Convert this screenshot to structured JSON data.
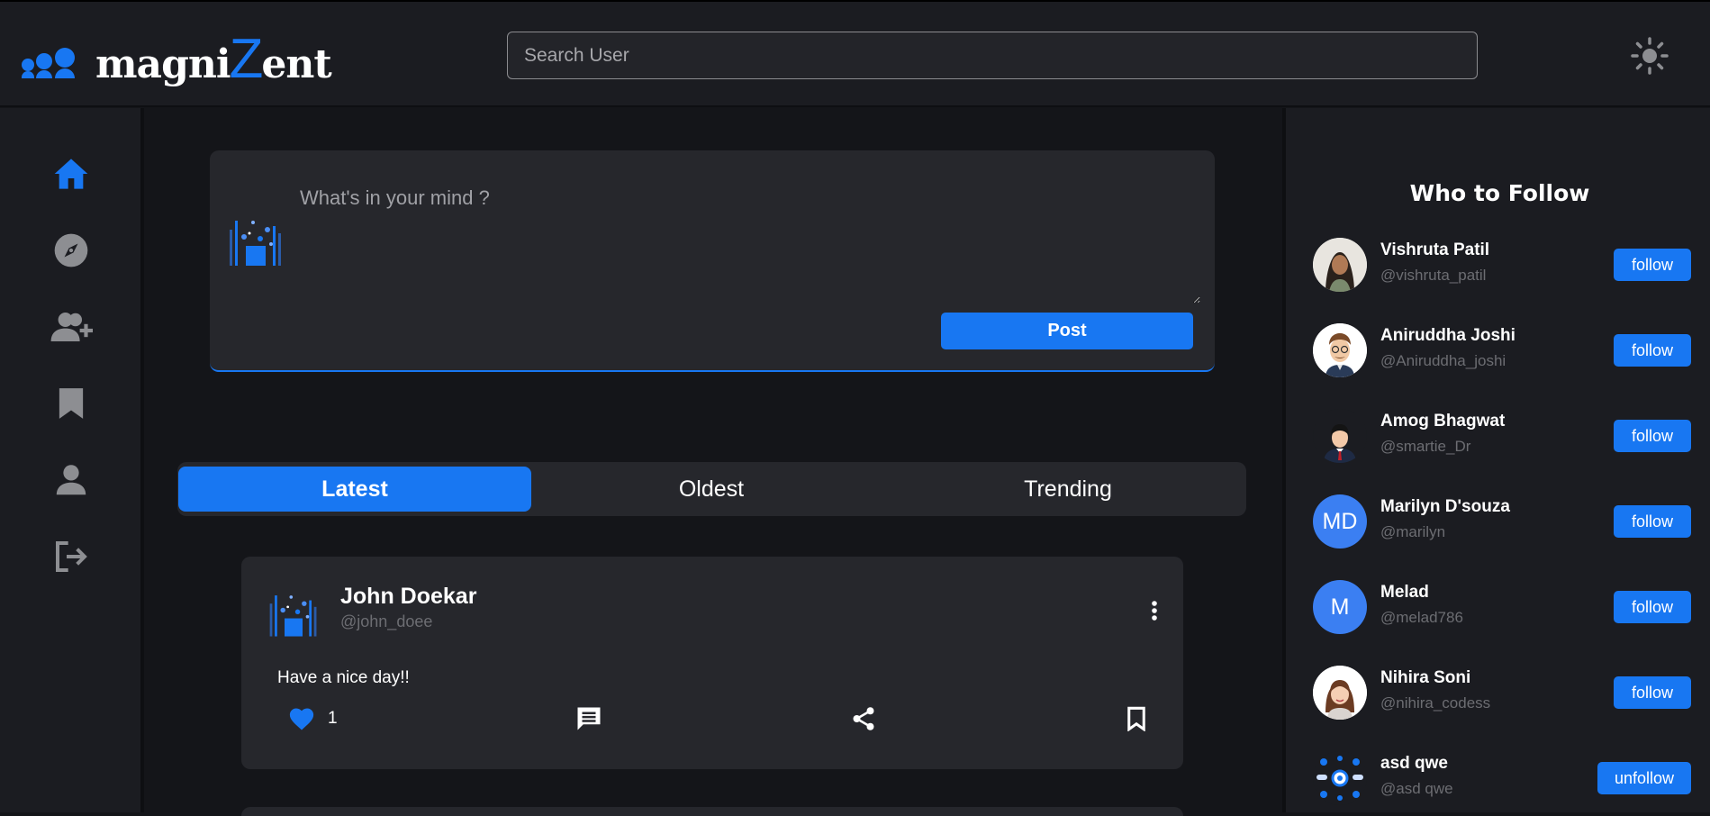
{
  "header": {
    "logo": {
      "prefix": "magni",
      "z": "Z",
      "suffix": "ent"
    },
    "search_placeholder": "Search User",
    "theme_icon": "sun-icon"
  },
  "sidebar": {
    "items": [
      {
        "name": "home",
        "icon": "home-icon",
        "active": true
      },
      {
        "name": "explore",
        "icon": "compass-icon",
        "active": false
      },
      {
        "name": "add-user",
        "icon": "add-user-icon",
        "active": false
      },
      {
        "name": "bookmarks",
        "icon": "bookmark-icon",
        "active": false
      },
      {
        "name": "profile",
        "icon": "person-icon",
        "active": false
      },
      {
        "name": "logout",
        "icon": "logout-icon",
        "active": false
      }
    ]
  },
  "composer": {
    "placeholder": "What's in your mind ?",
    "post_label": "Post"
  },
  "tabs": [
    {
      "label": "Latest",
      "active": true
    },
    {
      "label": "Oldest",
      "active": false
    },
    {
      "label": "Trending",
      "active": false
    }
  ],
  "post": {
    "author": "John Doekar",
    "handle": "@john_doee",
    "text": "Have a nice day!!",
    "likes": "1"
  },
  "who_to_follow": {
    "title": "Who to Follow",
    "users": [
      {
        "name": "Vishruta Patil",
        "handle": "@vishruta_patil",
        "button": "follow",
        "avatar": "photo",
        "initials": ""
      },
      {
        "name": "Aniruddha Joshi",
        "handle": "@Aniruddha_joshi",
        "button": "follow",
        "avatar": "photo",
        "initials": ""
      },
      {
        "name": "Amog Bhagwat",
        "handle": "@smartie_Dr",
        "button": "follow",
        "avatar": "photo",
        "initials": ""
      },
      {
        "name": "Marilyn D'souza",
        "handle": "@marilyn",
        "button": "follow",
        "avatar": "initials",
        "initials": "MD"
      },
      {
        "name": "Melad",
        "handle": "@melad786",
        "button": "follow",
        "avatar": "initials",
        "initials": "M"
      },
      {
        "name": "Nihira Soni",
        "handle": "@nihira_codess",
        "button": "follow",
        "avatar": "photo",
        "initials": ""
      },
      {
        "name": "asd qwe",
        "handle": "@asd qwe",
        "button": "unfollow",
        "avatar": "photo",
        "initials": ""
      }
    ]
  },
  "colors": {
    "accent": "#1877f2",
    "bg": "#141519",
    "panel": "#1b1c21",
    "card": "#26272c",
    "muted": "#6c6d72"
  }
}
